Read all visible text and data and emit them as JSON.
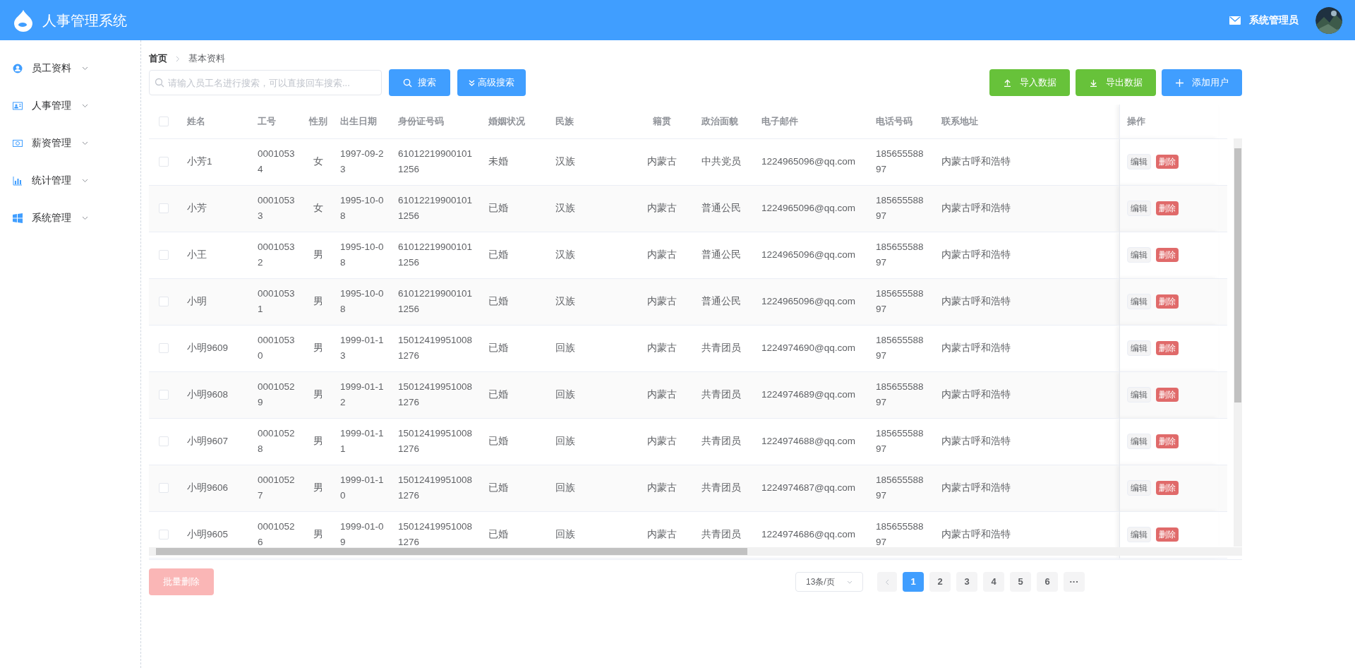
{
  "header": {
    "title": "人事管理系统",
    "user": "系统管理员"
  },
  "sidebar": {
    "items": [
      {
        "label": "员工资料"
      },
      {
        "label": "人事管理"
      },
      {
        "label": "薪资管理"
      },
      {
        "label": "统计管理"
      },
      {
        "label": "系统管理"
      }
    ]
  },
  "breadcrumb": [
    "首页",
    "基本资料"
  ],
  "toolbar": {
    "search": {
      "placeholder": "请输入员工名进行搜索，可以直接回车搜索..."
    },
    "search_button": "搜索",
    "advanced_button": "高级搜索",
    "import_button": "导入数据",
    "export_button": "导出数据",
    "add_button": "添加用户"
  },
  "table": {
    "all_checked": false,
    "columns": [
      "姓名",
      "工号",
      "性别",
      "出生日期",
      "身份证号码",
      "婚姻状况",
      "民族",
      "籍贯",
      "政治面貌",
      "电子邮件",
      "电话号码",
      "联系地址",
      "操作"
    ],
    "rows": [
      {
        "checked": false,
        "cells": [
          "小芳1",
          "00010534",
          "女",
          "1997-09-23",
          "610122199001011256",
          "未婚",
          "汉族",
          "内蒙古",
          "中共党员",
          "1224965096@qq.com",
          "18565558897",
          "内蒙古呼和浩特"
        ],
        "actions": [
          "编辑",
          "删除"
        ]
      },
      {
        "checked": false,
        "cells": [
          "小芳",
          "00010533",
          "女",
          "1995-10-08",
          "610122199001011256",
          "已婚",
          "汉族",
          "内蒙古",
          "普通公民",
          "1224965096@qq.com",
          "18565558897",
          "内蒙古呼和浩特"
        ],
        "actions": [
          "编辑",
          "删除"
        ]
      },
      {
        "checked": false,
        "cells": [
          "小王",
          "00010532",
          "男",
          "1995-10-08",
          "610122199001011256",
          "已婚",
          "汉族",
          "内蒙古",
          "普通公民",
          "1224965096@qq.com",
          "18565558897",
          "内蒙古呼和浩特"
        ],
        "actions": [
          "编辑",
          "删除"
        ]
      },
      {
        "checked": false,
        "cells": [
          "小明",
          "00010531",
          "男",
          "1995-10-08",
          "610122199001011256",
          "已婚",
          "汉族",
          "内蒙古",
          "普通公民",
          "1224965096@qq.com",
          "18565558897",
          "内蒙古呼和浩特"
        ],
        "actions": [
          "编辑",
          "删除"
        ]
      },
      {
        "checked": false,
        "cells": [
          "小明9609",
          "00010530",
          "男",
          "1999-01-13",
          "150124199510081276",
          "已婚",
          "回族",
          "内蒙古",
          "共青团员",
          "1224974690@qq.com",
          "18565558897",
          "内蒙古呼和浩特"
        ],
        "actions": [
          "编辑",
          "删除"
        ]
      },
      {
        "checked": false,
        "cells": [
          "小明9608",
          "00010529",
          "男",
          "1999-01-12",
          "150124199510081276",
          "已婚",
          "回族",
          "内蒙古",
          "共青团员",
          "1224974689@qq.com",
          "18565558897",
          "内蒙古呼和浩特"
        ],
        "actions": [
          "编辑",
          "删除"
        ]
      },
      {
        "checked": false,
        "cells": [
          "小明9607",
          "00010528",
          "男",
          "1999-01-11",
          "150124199510081276",
          "已婚",
          "回族",
          "内蒙古",
          "共青团员",
          "1224974688@qq.com",
          "18565558897",
          "内蒙古呼和浩特"
        ],
        "actions": [
          "编辑",
          "删除"
        ]
      },
      {
        "checked": false,
        "cells": [
          "小明9606",
          "00010527",
          "男",
          "1999-01-10",
          "150124199510081276",
          "已婚",
          "回族",
          "内蒙古",
          "共青团员",
          "1224974687@qq.com",
          "18565558897",
          "内蒙古呼和浩特"
        ],
        "actions": [
          "编辑",
          "删除"
        ]
      },
      {
        "checked": false,
        "cells": [
          "小明9605",
          "00010526",
          "男",
          "1999-01-09",
          "150124199510081276",
          "已婚",
          "回族",
          "内蒙古",
          "共青团员",
          "1224974686@qq.com",
          "18565558897",
          "内蒙古呼和浩特"
        ],
        "actions": [
          "编辑",
          "删除"
        ]
      }
    ]
  },
  "batch_delete": {
    "label": "批量删除",
    "disabled": true
  },
  "pagination": {
    "page_size": "13条/页",
    "prev_disabled": true,
    "pages": [
      {
        "label": "1",
        "selected": true
      },
      {
        "label": "2",
        "selected": false
      },
      {
        "label": "3",
        "selected": false
      },
      {
        "label": "4",
        "selected": false
      },
      {
        "label": "5",
        "selected": false
      },
      {
        "label": "6",
        "selected": false
      },
      {
        "label": "···",
        "selected": false
      }
    ]
  }
}
